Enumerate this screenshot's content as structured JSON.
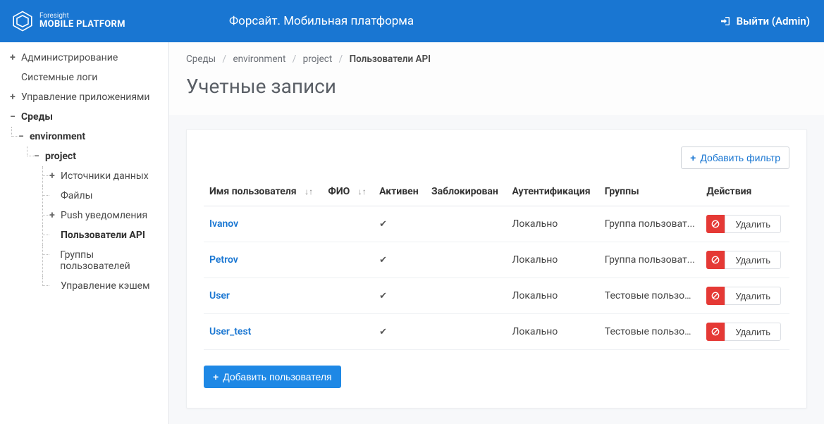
{
  "brand": {
    "sup": "Foresight",
    "main": "MOBILE PLATFORM"
  },
  "header": {
    "title": "Форсайт. Мобильная платформа",
    "logout": "Выйти (Admin)"
  },
  "sidebar": {
    "admin": "Администрирование",
    "syslogs": "Системные логи",
    "apps": "Управление приложениями",
    "env_root": "Среды",
    "env": "environment",
    "project": "project",
    "items": [
      "Источники данных",
      "Файлы",
      "Push уведомления",
      "Пользователи API",
      "Группы пользователей",
      "Управление кэшем"
    ]
  },
  "breadcrumbs": {
    "a": "Среды",
    "b": "environment",
    "c": "project",
    "d": "Пользователи API"
  },
  "page": {
    "title": "Учетные записи"
  },
  "toolbar": {
    "add_filter": "Добавить фильтр",
    "add_user": "Добавить пользователя"
  },
  "table": {
    "headers": {
      "username": "Имя пользователя",
      "fio": "ФИО",
      "active": "Активен",
      "blocked": "Заблокирован",
      "auth": "Аутентификация",
      "groups": "Группы",
      "actions": "Действия"
    },
    "delete_label": "Удалить",
    "rows": [
      {
        "username": "Ivanov",
        "fio": "",
        "active": true,
        "blocked": "",
        "auth": "Локально",
        "groups": "Группа пользоват..."
      },
      {
        "username": "Petrov",
        "fio": "",
        "active": true,
        "blocked": "",
        "auth": "Локально",
        "groups": "Группа пользоват..."
      },
      {
        "username": "User",
        "fio": "",
        "active": true,
        "blocked": "",
        "auth": "Локально",
        "groups": "Тестовые пользов..."
      },
      {
        "username": "User_test",
        "fio": "",
        "active": true,
        "blocked": "",
        "auth": "Локально",
        "groups": "Тестовые пользов..."
      }
    ]
  }
}
